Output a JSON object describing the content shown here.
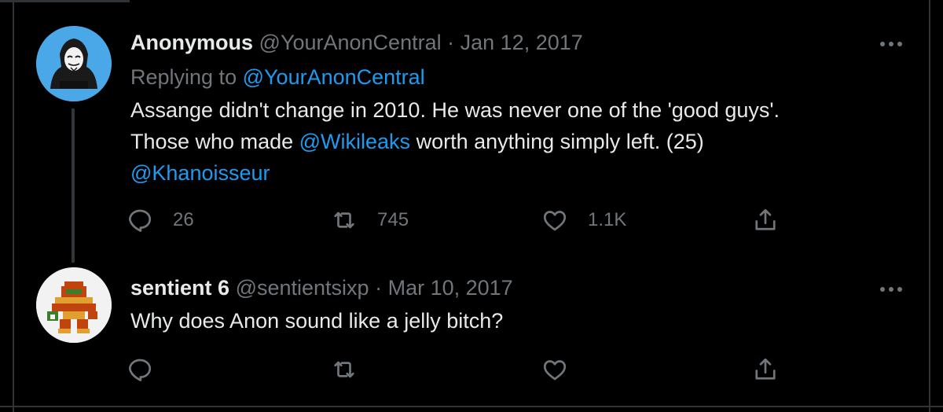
{
  "tweets": [
    {
      "display_name": "Anonymous",
      "handle": "@YourAnonCentral",
      "separator": "·",
      "date": "Jan 12, 2017",
      "replying_prefix": "Replying to",
      "replying_to": "@YourAnonCentral",
      "body": {
        "line1": "Assange didn't change in 2010. He was never one of the 'good guys'.",
        "line2_pre": "Those who made",
        "line2_mention": "@Wikileaks",
        "line2_post": "worth anything simply left. (25)",
        "line3_mention": "@Khanoisseur"
      },
      "replies_count": "26",
      "retweets_count": "745",
      "likes_count": "1.1K",
      "avatar_icon": "anonymous-mask-icon",
      "avatar_bg": "#4aa8e8"
    },
    {
      "display_name": "sentient 6",
      "handle": "@sentientsixp",
      "separator": "·",
      "date": "Mar 10, 2017",
      "body": {
        "line1": "Why does Anon sound like a jelly bitch?"
      },
      "replies_count": "",
      "retweets_count": "",
      "likes_count": "",
      "avatar_icon": "pixel-samus-icon",
      "avatar_bg": "#f2f2f2"
    }
  ],
  "colors": {
    "background": "#000000",
    "text_primary": "#e7e9ea",
    "text_secondary": "#71767b",
    "link": "#1d9bf0",
    "divider": "#2f3336"
  },
  "icons": [
    "reply-icon",
    "retweet-icon",
    "like-icon",
    "share-icon",
    "more-icon"
  ]
}
